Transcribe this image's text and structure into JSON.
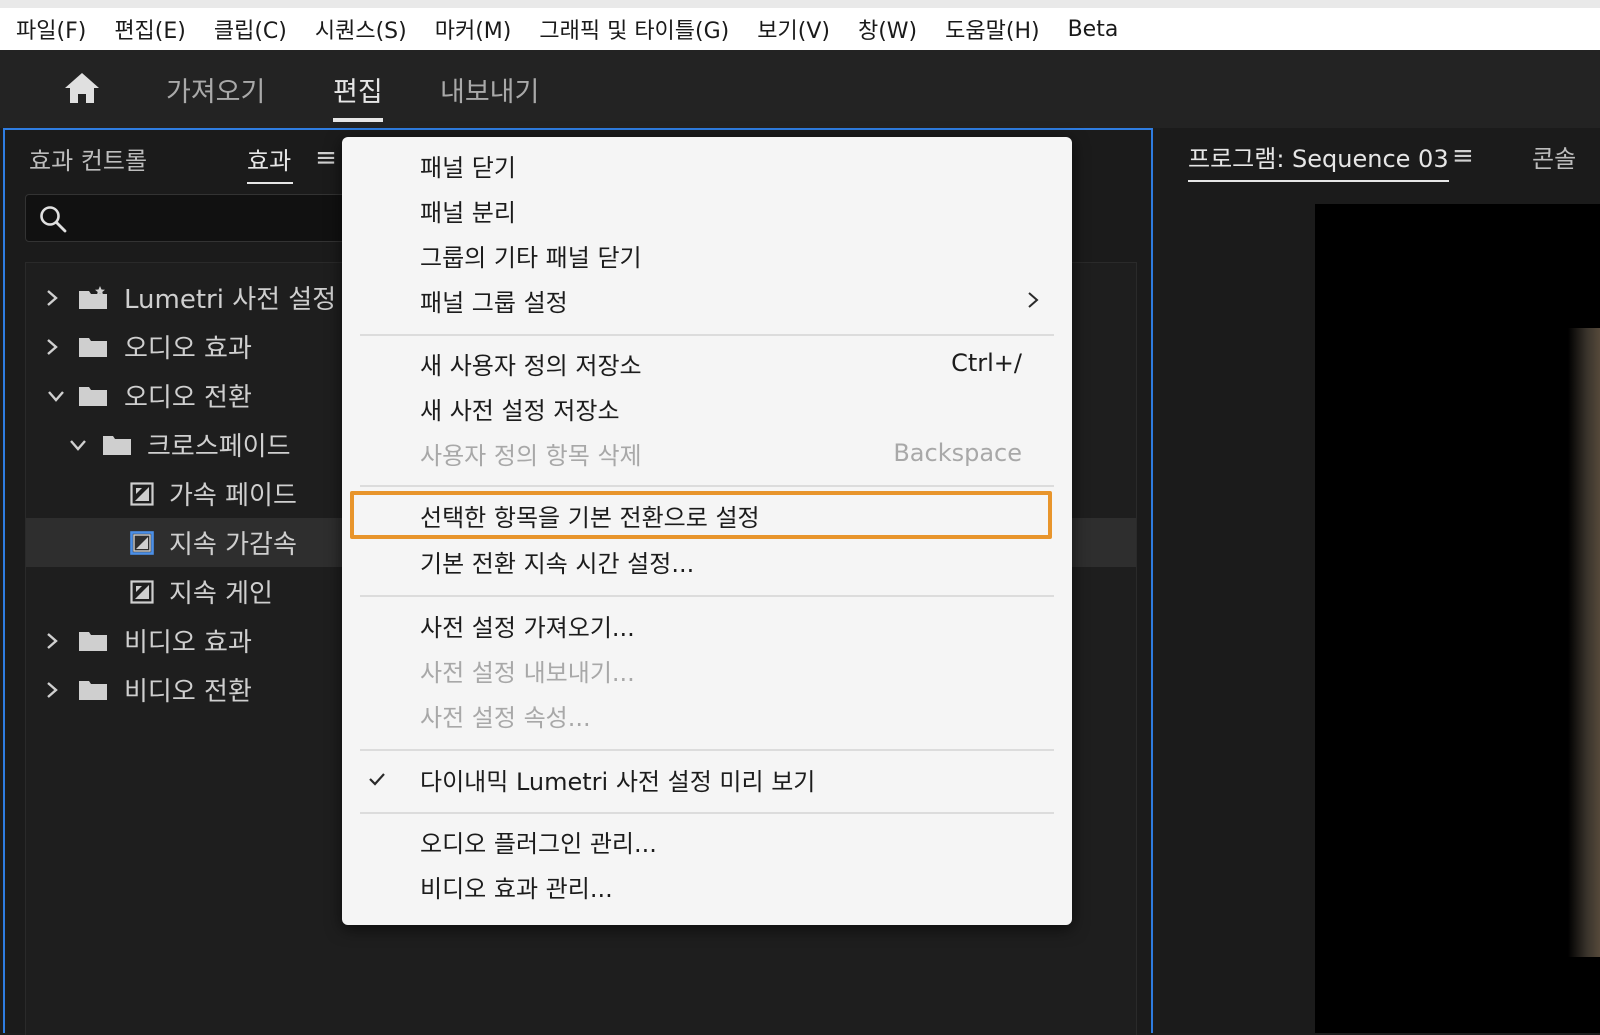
{
  "menubar": {
    "items": [
      "파일(F)",
      "편집(E)",
      "클립(C)",
      "시퀀스(S)",
      "마커(M)",
      "그래픽 및 타이틀(G)",
      "보기(V)",
      "창(W)",
      "도움말(H)",
      "Beta"
    ]
  },
  "workspace": {
    "home_icon": "home-icon",
    "tabs": [
      "가져오기",
      "편집",
      "내보내기"
    ],
    "active_tab": "편집"
  },
  "effects_panel": {
    "tab_effect_controls": "효과 컨트롤",
    "tab_effects": "효과",
    "menu_icon": "≡",
    "search_placeholder": "",
    "tree": [
      {
        "label": "Lumetri 사전 설정",
        "type": "folder-special",
        "expanded": false,
        "depth": 0
      },
      {
        "label": "오디오 효과",
        "type": "folder",
        "expanded": false,
        "depth": 0
      },
      {
        "label": "오디오 전환",
        "type": "folder",
        "expanded": true,
        "depth": 0
      },
      {
        "label": "크로스페이드",
        "type": "folder",
        "expanded": true,
        "depth": 1
      },
      {
        "label": "가속 페이드",
        "type": "effect",
        "depth": 2
      },
      {
        "label": "지속 가감속",
        "type": "effect",
        "depth": 2,
        "selected": true
      },
      {
        "label": "지속 게인",
        "type": "effect",
        "depth": 2
      },
      {
        "label": "비디오 효과",
        "type": "folder",
        "expanded": false,
        "depth": 0
      },
      {
        "label": "비디오 전환",
        "type": "folder",
        "expanded": false,
        "depth": 0
      }
    ]
  },
  "program_panel": {
    "tab_label": "프로그램: Sequence 03",
    "menu_icon": "≡",
    "console_tab": "콘솔"
  },
  "context_menu": {
    "groups": [
      [
        {
          "label": "패널 닫기"
        },
        {
          "label": "패널 분리"
        },
        {
          "label": "그룹의 기타 패널 닫기"
        },
        {
          "label": "패널 그룹 설정",
          "submenu": true
        }
      ],
      [
        {
          "label": "새 사용자 정의 저장소",
          "shortcut": "Ctrl+/"
        },
        {
          "label": "새 사전 설정 저장소"
        },
        {
          "label": "사용자 정의 항목 삭제",
          "shortcut": "Backspace",
          "disabled": true
        }
      ],
      [
        {
          "label": "선택한 항목을 기본 전환으로 설정",
          "highlighted": true
        },
        {
          "label": "기본 전환 지속 시간 설정..."
        }
      ],
      [
        {
          "label": "사전 설정 가져오기..."
        },
        {
          "label": "사전 설정 내보내기...",
          "disabled": true
        },
        {
          "label": "사전 설정 속성...",
          "disabled": true
        }
      ],
      [
        {
          "label": "다이내믹 Lumetri 사전 설정 미리 보기",
          "checked": true
        }
      ],
      [
        {
          "label": "오디오 플러그인 관리..."
        },
        {
          "label": "비디오 효과 관리..."
        }
      ]
    ],
    "highlight_color": "#e8952c"
  }
}
